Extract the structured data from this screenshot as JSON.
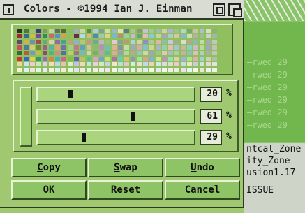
{
  "window": {
    "title": "Colors - ©1994 Ian J. Einman"
  },
  "palette": {
    "colors": [
      "#2e2e2e",
      "#4b7a3b",
      "#a2c37a",
      "#3c3c7c",
      "#7e9e5e",
      "#bed69e",
      "#6a6a6a",
      "#556b2f",
      "#8db96a",
      "#a8a8c8",
      "#c8d6a8",
      "#5c8c4c",
      "#b6c9e0",
      "#7c9fa0",
      "#d1dba3",
      "#9bb7cc",
      "#e5e0b0",
      "#607a88",
      "#b0c490",
      "#889878",
      "#c8c0d8",
      "#9ec8a0",
      "#a5b8b0",
      "#cbd49e",
      "#adb0e0",
      "#9cc28e",
      "#b9d2c6",
      "#7aa86c",
      "#c9c4a8",
      "#acc0d4",
      "#d6e0c0",
      "#88b470",
      "#9a2c3a",
      "#3c6c8c",
      "#cfc040",
      "#7a4a9a",
      "#2f8c5c",
      "#c86a6a",
      "#5c90c0",
      "#d0a05a",
      "#8abf62",
      "#6a2c4c",
      "#b8d8e8",
      "#d8b880",
      "#4c8cb0",
      "#a0c8b0",
      "#e0d090",
      "#7ab8c8",
      "#c08c70",
      "#9ad0a0",
      "#c8b8e0",
      "#70a070",
      "#e0c0b0",
      "#90c8d8",
      "#c0d890",
      "#b0a0c0",
      "#a8d0b8",
      "#d8c8a0",
      "#88b8d0",
      "#c8e0b0",
      "#b8b0a8",
      "#98c098",
      "#d0d0c0",
      "#a0b8a8",
      "#5c4c6c",
      "#d0b050",
      "#7090b0",
      "#a04c4c",
      "#60b070",
      "#e0d0a0",
      "#8c6caa",
      "#4ca08c",
      "#c0a080",
      "#90b0d0",
      "#b8c870",
      "#d09090",
      "#70a8a0",
      "#c8b0c8",
      "#a0c070",
      "#e0c8d8",
      "#80a890",
      "#c09870",
      "#b0d0e0",
      "#d8d0a8",
      "#9090c0",
      "#b0c8a0",
      "#e0b8a0",
      "#88c0a8",
      "#c8c8e0",
      "#a0b080",
      "#d8e0c8",
      "#b8a890",
      "#90b8b8",
      "#c8d8a0",
      "#a8a8b8",
      "#b8d0b0",
      "#c84c5c",
      "#4c7ca0",
      "#d8c870",
      "#6c8c3c",
      "#a05c8c",
      "#5cb0a0",
      "#e0a070",
      "#7070b0",
      "#a0d080",
      "#c07890",
      "#60a0c0",
      "#d0c0a0",
      "#8cb870",
      "#b890c0",
      "#70c0b0",
      "#e0b090",
      "#9090a0",
      "#c0e0a0",
      "#a8a0d0",
      "#d8a8b0",
      "#80c0d0",
      "#c8d890",
      "#b0b0c8",
      "#98d0a8",
      "#e0c0a8",
      "#a8c0d8",
      "#c0b8a0",
      "#88d0c0",
      "#d0b8c8",
      "#b8d8a0",
      "#a0a8b8",
      "#c8c0b0",
      "#3a6a3a",
      "#b0603c",
      "#6c9cd0",
      "#c0c040",
      "#8c4c70",
      "#4cb880",
      "#d08c8c",
      "#5c6ca0",
      "#b8d070",
      "#a0708c",
      "#70b8d0",
      "#d8d0b0",
      "#80a870",
      "#c098b8",
      "#60b8a0",
      "#e0a8a0",
      "#9c9cc0",
      "#b0d8a0",
      "#c8a0a0",
      "#90c8c8",
      "#d0d8a8",
      "#a8a0c0",
      "#98c890",
      "#e0c8b8",
      "#b0b8d0",
      "#a8d0a0",
      "#c8b0a8",
      "#90c0b8",
      "#d8c0c8",
      "#b0d0b8",
      "#a8b0a8",
      "#c0c8b8",
      "#cc3333",
      "#3366cc",
      "#e0d050",
      "#339966",
      "#9966cc",
      "#e08040",
      "#40b0d0",
      "#d06090",
      "#80c040",
      "#6060c0",
      "#c0c060",
      "#50c0a0",
      "#e0a0c0",
      "#70a0e0",
      "#c0e070",
      "#b070a0",
      "#60d0c0",
      "#e0c070",
      "#9090d0",
      "#a0e0a0",
      "#e0a090",
      "#80b0e0",
      "#d0e090",
      "#c090c0",
      "#90e0c0",
      "#e0d0a0",
      "#a0b0e0",
      "#b0e090",
      "#e0b0b0",
      "#a0d0e0",
      "#d0d0b0",
      "#b0c0a0",
      "#e8d8a0",
      "#d0e0f0",
      "#f0c8d0",
      "#c8e8c0",
      "#e0d0f0",
      "#f0e0b0",
      "#b8d8e8",
      "#e8c0b0",
      "#d8f0c8",
      "#c8c0e8",
      "#f0d8c0",
      "#c0e8d8",
      "#e8d0e0",
      "#d8e8b0",
      "#c8d0f0",
      "#f0e8c8",
      "#b8e0d0",
      "#e0c8c8",
      "#d0f0d8",
      "#e8e0d0",
      "#c0d8f0",
      "#f0d0b8",
      "#c8f0e0",
      "#e0d8e8",
      "#d8e0c0",
      "#f0c8c8",
      "#c0e0e8",
      "#e8e8c0",
      "#d0c8e0",
      "#c8e8d0",
      "#e8d8d8",
      "#d8e8e0",
      "#f8f0d0",
      "#e0f0f8",
      "#f8e0e0",
      "#e0f8e0",
      "#f0e8f8",
      "#f8f0e0",
      "#d8f0f0",
      "#f8e8d8",
      "#e8f8e0",
      "#e8e0f8",
      "#f8e8e8",
      "#e0f8f0",
      "#f0f0e0",
      "#e8f0f8",
      "#f8e0f0",
      "#f0f8e8",
      "#e0e8f0",
      "#f8f0f0",
      "#e8f8f8",
      "#f0e8e0",
      "#e0f0e8",
      "#f8f8e8",
      "#e8e8f8",
      "#f0f8f0",
      "#f8e8f0",
      "#e8f0e0",
      "#f0e0e8",
      "#e0f8f8",
      "#f8f8f0",
      "#e8e8e0",
      "#f0f0f8",
      "#f8f0e8"
    ]
  },
  "sliders": {
    "red": {
      "value": 20,
      "value_label": "20",
      "unit": "%"
    },
    "green": {
      "value": 61,
      "value_label": "61",
      "unit": "%"
    },
    "blue": {
      "value": 29,
      "value_label": "29",
      "unit": "%"
    }
  },
  "buttons": {
    "copy": {
      "label": "Copy",
      "u": "C",
      "rest": "opy"
    },
    "swap": {
      "label": "Swap",
      "u": "S",
      "rest": "wap"
    },
    "undo": {
      "label": "Undo",
      "u": "U",
      "rest": "ndo"
    },
    "ok": {
      "label": "OK"
    },
    "reset": {
      "label": "Reset"
    },
    "cancel": {
      "label": "Cancel"
    }
  },
  "background_window": {
    "lines": [
      "—rwed 29",
      "—rwed 29",
      "—rwed 29",
      "—rwed 29",
      "—rwed 29",
      "—rwed 29"
    ],
    "text": [
      "ntcal_Zone",
      "ity_Zone",
      "usion1.17",
      "ISSUE"
    ]
  }
}
